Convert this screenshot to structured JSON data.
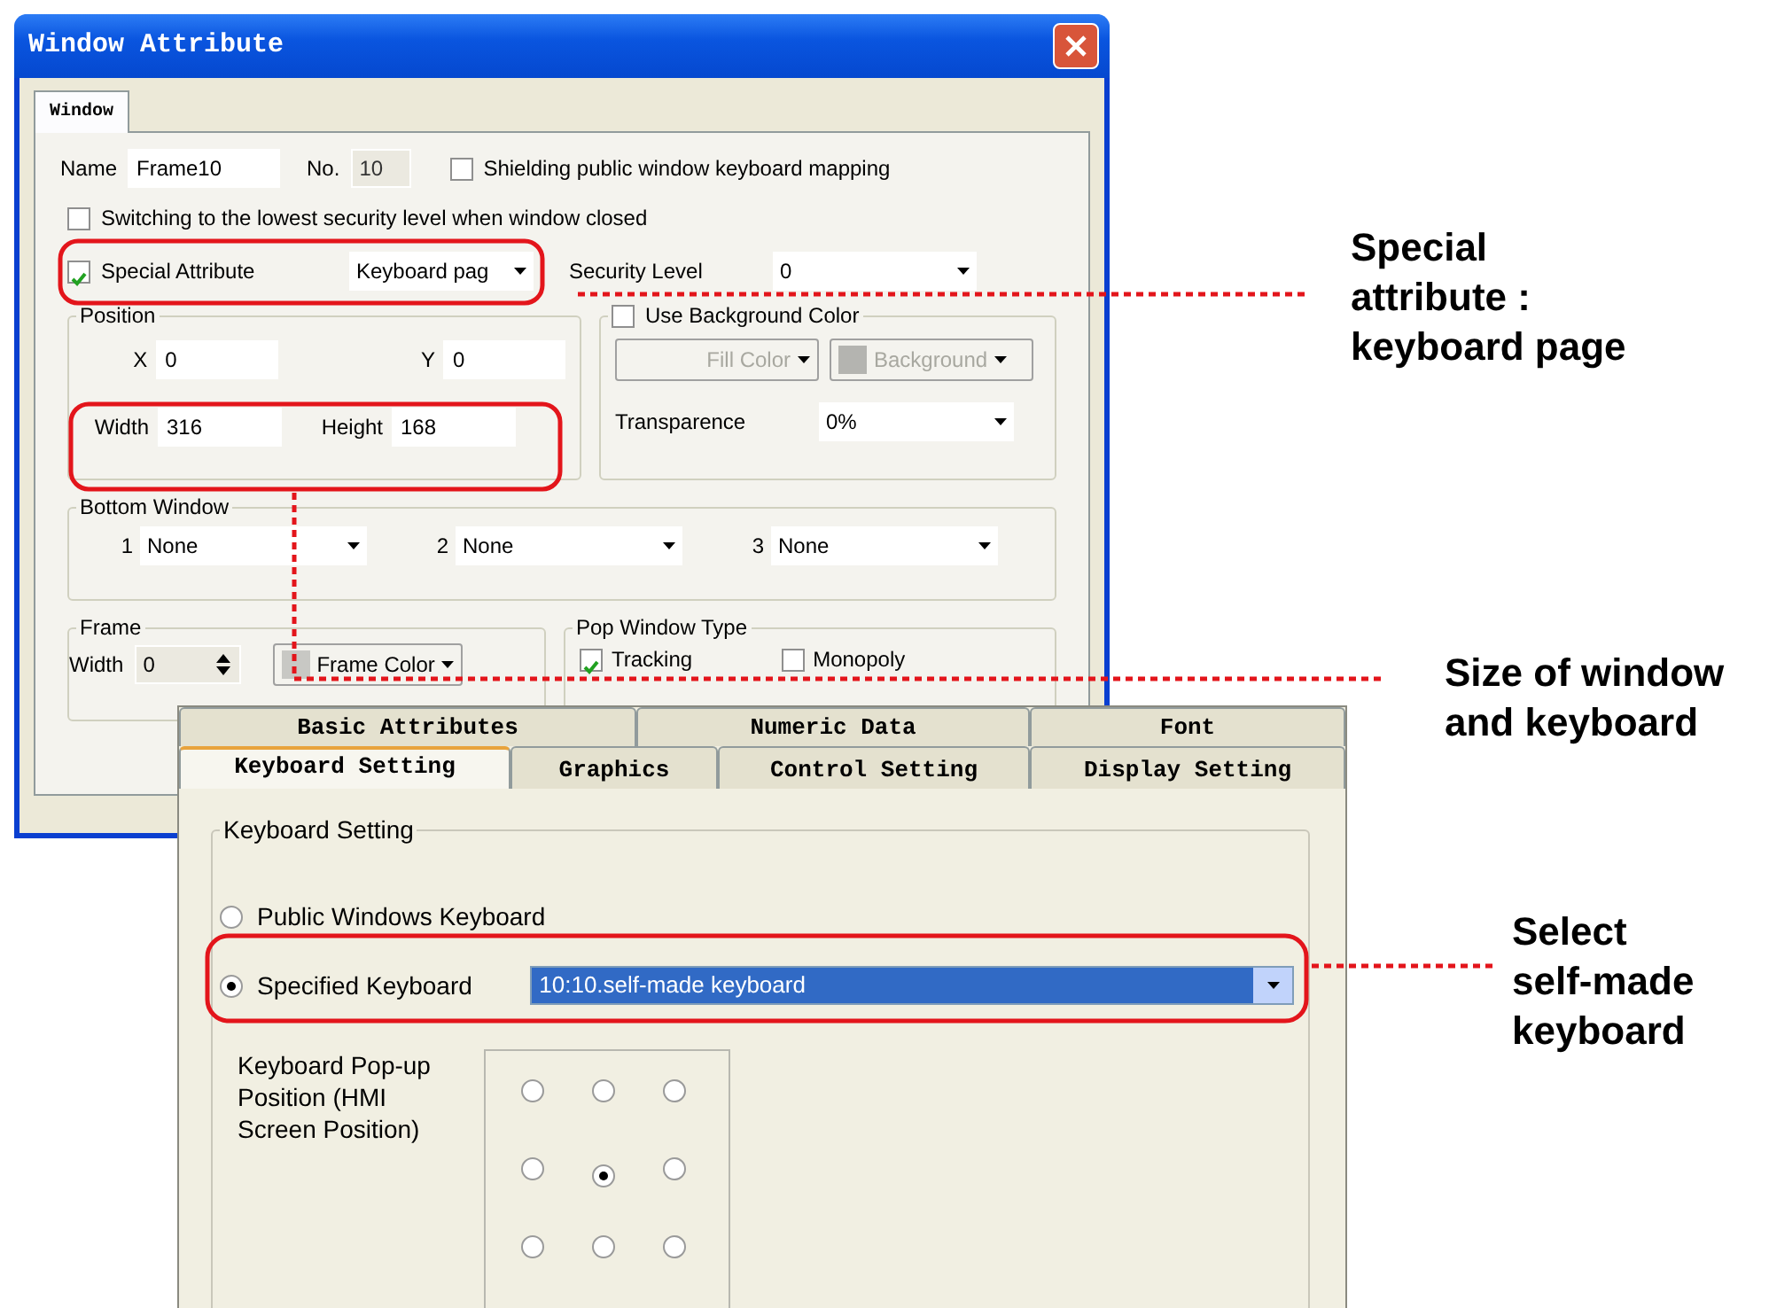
{
  "window_attribute": {
    "title": "Window Attribute",
    "tabs": [
      {
        "label": "Window",
        "selected": true
      }
    ],
    "name": {
      "label": "Name",
      "value": "Frame10"
    },
    "number": {
      "label": "No.",
      "value": "10",
      "disabled": true
    },
    "shielding": {
      "label": "Shielding public window keyboard mapping",
      "checked": false
    },
    "switching": {
      "label": "Switching to the lowest security level when window closed",
      "checked": false
    },
    "special_attribute": {
      "label": "Special Attribute",
      "checked": true,
      "value": "Keyboard pag"
    },
    "security_level": {
      "label": "Security Level",
      "value": "0"
    },
    "position": {
      "title": "Position",
      "fields": [
        {
          "label": "X",
          "value": "0"
        },
        {
          "label": "Y",
          "value": "0"
        },
        {
          "label": "Width",
          "value": "316"
        },
        {
          "label": "Height",
          "value": "168"
        }
      ]
    },
    "background": {
      "checkbox": {
        "label": "Use Background Color",
        "checked": false
      },
      "disabled": true,
      "fill_color": "Fill Color",
      "background_button": "Background",
      "transparence": {
        "label": "Transparence",
        "value": "0%"
      }
    },
    "bottom_window": {
      "title": "Bottom Window",
      "slots": [
        {
          "label": "1",
          "value": "None"
        },
        {
          "label": "2",
          "value": "None"
        },
        {
          "label": "3",
          "value": "None"
        }
      ]
    },
    "frame": {
      "title": "Frame",
      "width_label": "Width",
      "width_value": "0",
      "color_button": "Frame Color"
    },
    "pop_window_type": {
      "title": "Pop Window Type",
      "options": [
        {
          "label": "Tracking",
          "checked": true
        },
        {
          "label": "Monopoly",
          "checked": false
        }
      ]
    }
  },
  "keyboard_dialog": {
    "tab_rows": [
      [
        {
          "label": "Basic Attributes",
          "selected": false
        },
        {
          "label": "Numeric Data",
          "selected": false
        },
        {
          "label": "Font",
          "selected": false
        }
      ],
      [
        {
          "label": "Keyboard Setting",
          "selected": true
        },
        {
          "label": "Graphics",
          "selected": false
        },
        {
          "label": "Control Setting",
          "selected": false
        },
        {
          "label": "Display Setting",
          "selected": false
        }
      ]
    ],
    "group_title": "Keyboard Setting",
    "keyboard_options": [
      {
        "label": "Public Windows Keyboard",
        "selected": false
      },
      {
        "label": "Specified Keyboard",
        "selected": true,
        "value": "10:10.self-made keyboard"
      }
    ],
    "popup_position": {
      "label": "Keyboard Pop-up Position (HMI Screen Position)",
      "grid": [
        {
          "selected": false
        },
        {
          "selected": false
        },
        {
          "selected": false
        },
        {
          "selected": false
        },
        {
          "selected": true
        },
        {
          "selected": false
        },
        {
          "selected": false
        },
        {
          "selected": false
        },
        {
          "selected": false
        }
      ]
    }
  },
  "annotations": [
    {
      "text": "Special\nattribute :\nkeyboard page"
    },
    {
      "text": "Size of window\nand keyboard"
    },
    {
      "text": "Select\nself-made\nkeyboard"
    }
  ]
}
